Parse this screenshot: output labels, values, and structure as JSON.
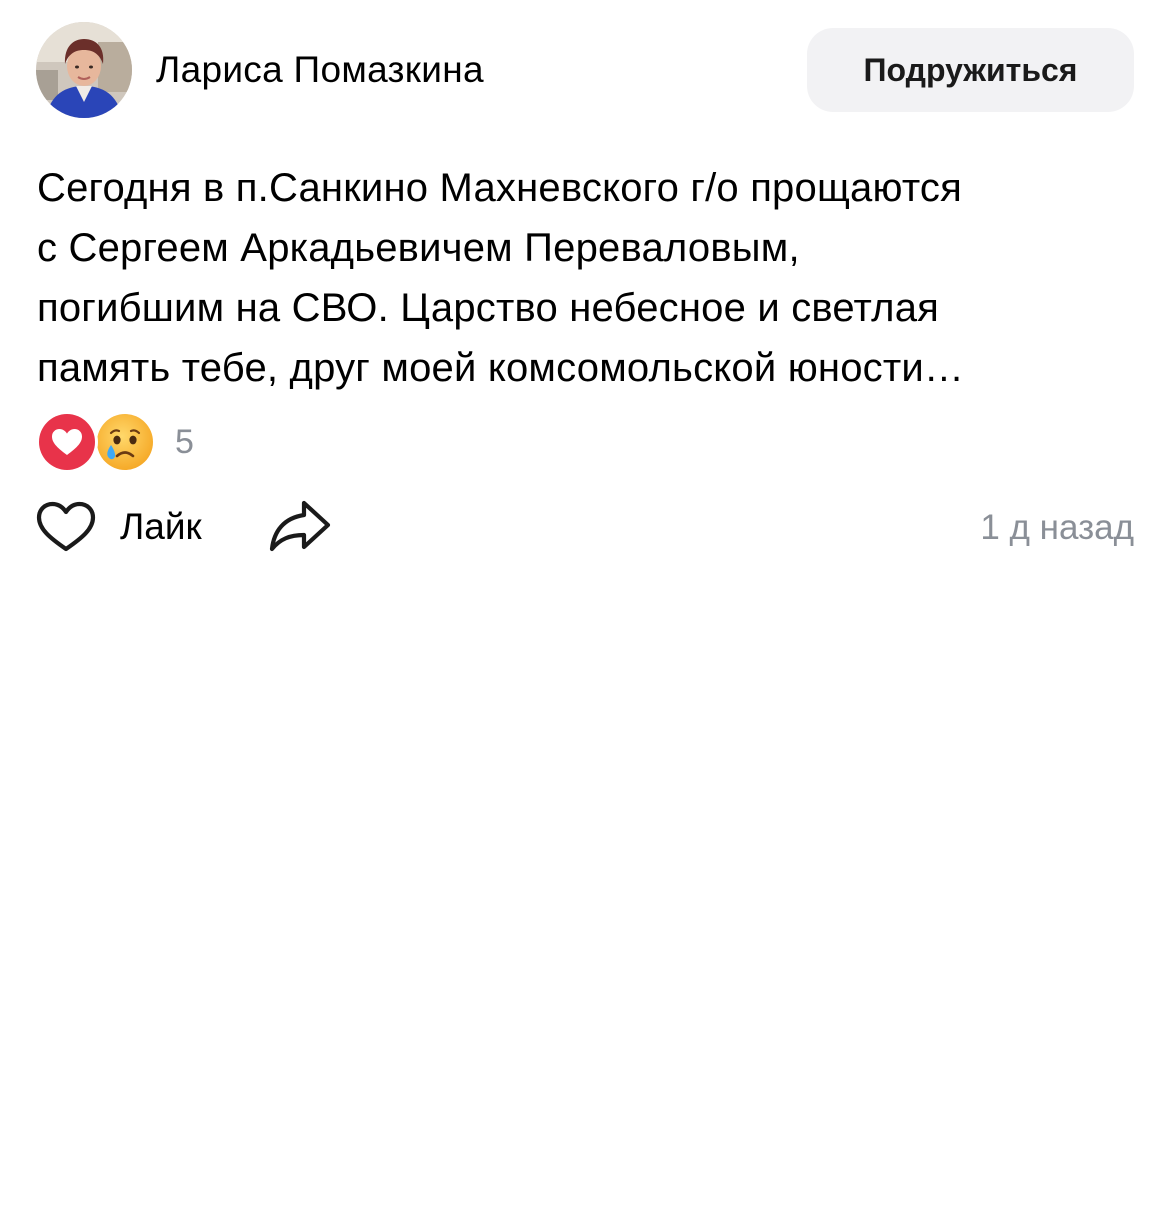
{
  "author": {
    "name": "Лариса Помазкина",
    "avatar_icon": "user-photo"
  },
  "header": {
    "befriend_label": "Подружиться"
  },
  "post": {
    "text": "Сегодня в п.Санкино Махневского г/о прощаются\nс Сергеем Аркадьевичем Переваловым,\nпогибшим на СВО.  Царство небесное и светлая\nпамять тебе, друг моей комсомольской юности…"
  },
  "reactions": {
    "items": [
      "heart",
      "crying-face"
    ],
    "count": "5"
  },
  "actions": {
    "like_label": "Лайк",
    "like_icon": "heart-outline-icon",
    "share_icon": "share-arrow-icon",
    "timestamp": "1 д назад"
  },
  "colors": {
    "secondary_text": "#8a8f97",
    "button_bg": "#f2f2f4",
    "heart_red": "#e8334a"
  }
}
